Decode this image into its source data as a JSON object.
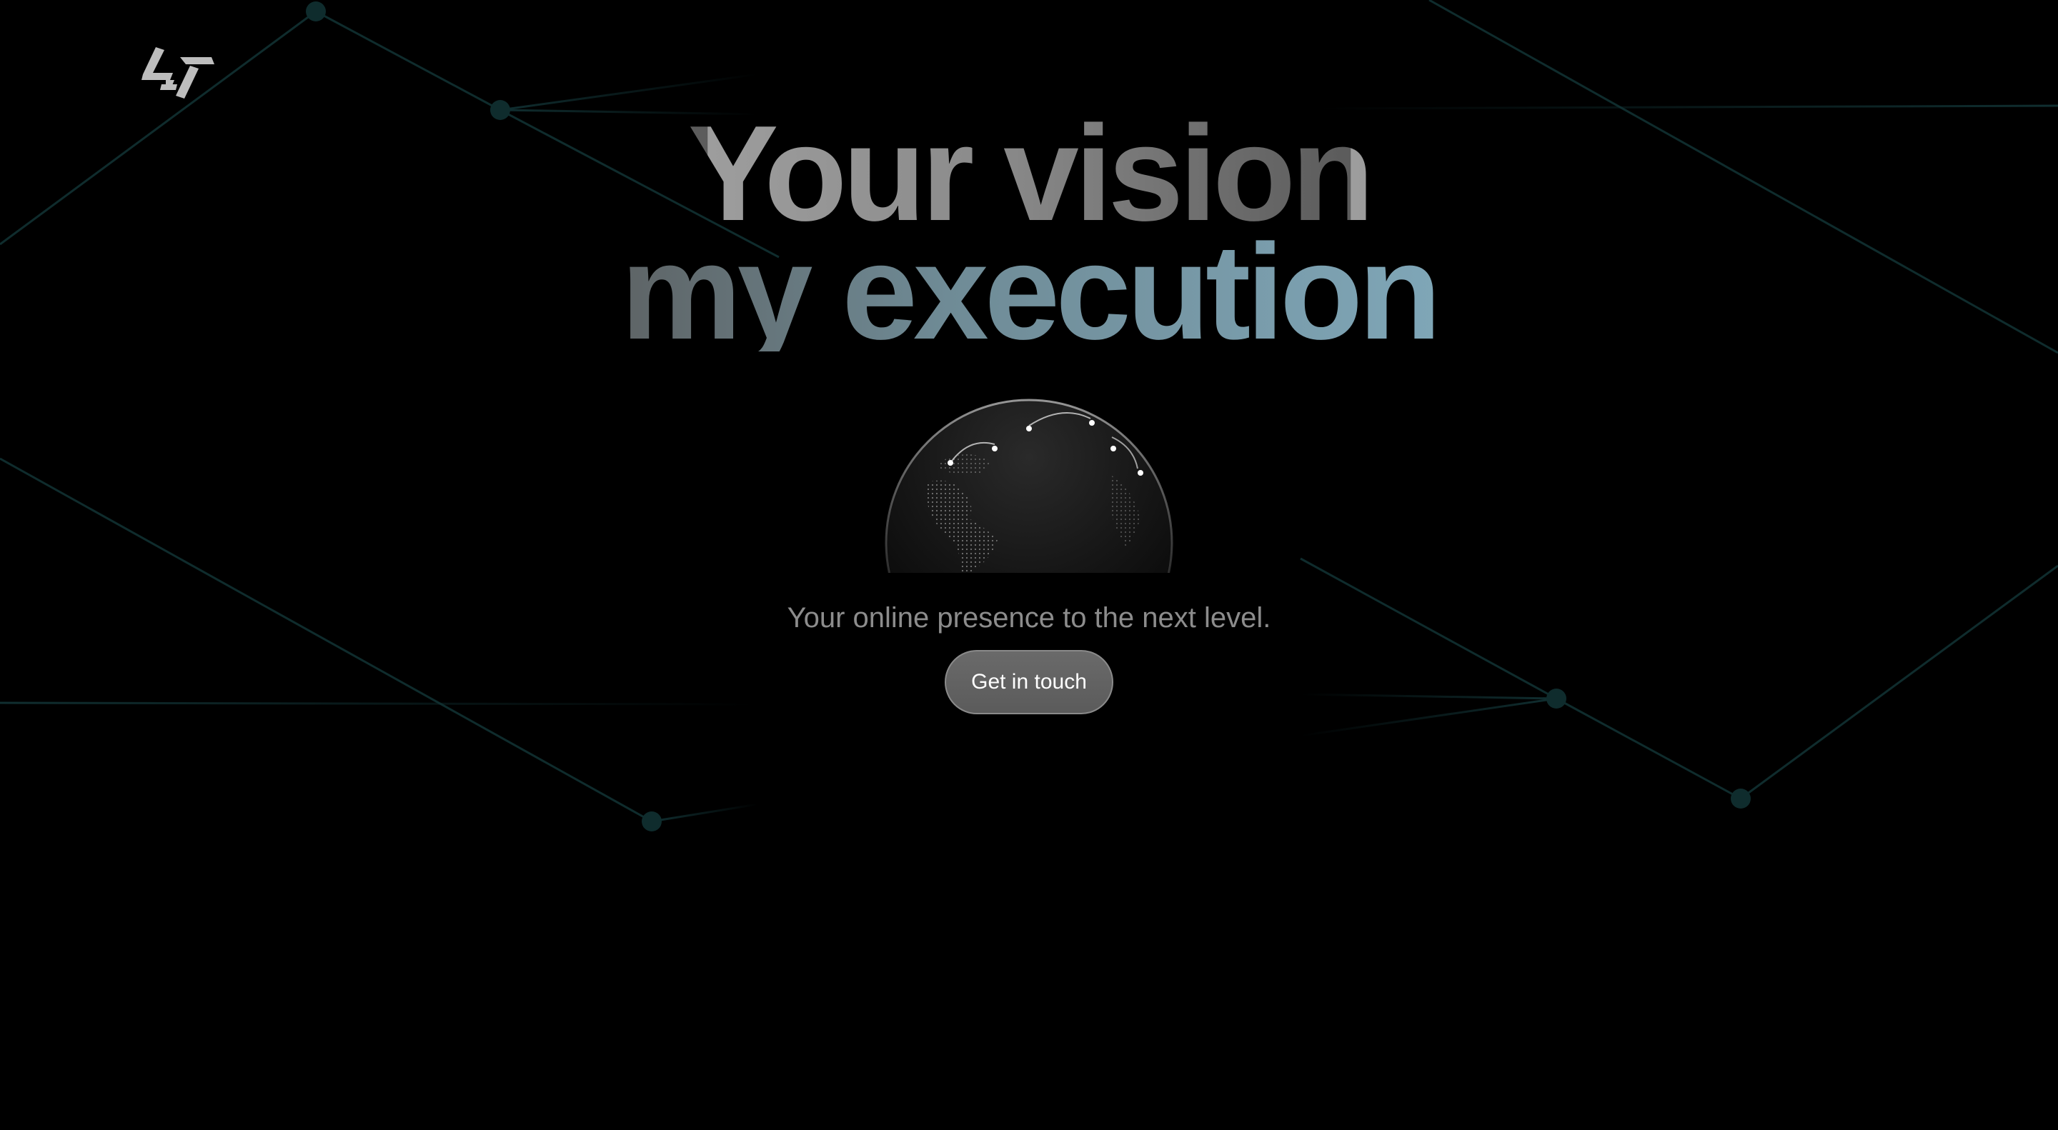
{
  "brand": {
    "logo_icon": "zigzag-logo-icon"
  },
  "hero": {
    "headline_line_1": "Your vision",
    "headline_line_2": "my execution",
    "tagline": "Your online presence to the next level.",
    "cta_label": "Get in touch"
  },
  "colors": {
    "background": "#000000",
    "network_lines": "#0f2a2a",
    "headline_top": "#9d9d9d",
    "headline_bottom_accent": "#7fa6b7",
    "tagline": "#8c8c8c",
    "button_fill": "#646464"
  },
  "icons": {
    "globe": "globe-icon"
  }
}
